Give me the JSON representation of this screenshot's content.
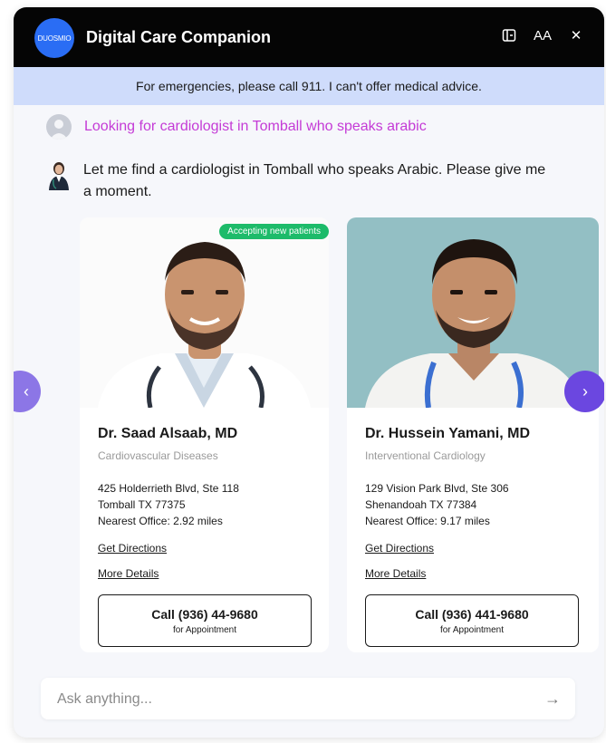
{
  "header": {
    "logo_text": "DUOSMIO",
    "title": "Digital Care Companion",
    "icons": [
      "layout-icon",
      "font-size-icon",
      "close-icon"
    ],
    "font_label": "AA",
    "close_glyph": "✕"
  },
  "banner": {
    "text": "For emergencies, please call 911. I can't offer medical advice."
  },
  "user_message": {
    "text": "Looking for cardiologist in Tomball who speaks arabic"
  },
  "bot_message": {
    "text": "Let me find a cardiologist in Tomball who speaks Arabic. Please give me a moment."
  },
  "cards": [
    {
      "badge": "Accepting new patients",
      "name": "Dr. Saad Alsaab, MD",
      "specialty": "Cardiovascular Diseases",
      "address_line1": "425 Holderrieth Blvd, Ste 118",
      "address_line2": "Tomball TX 77375",
      "nearest_office": "Nearest Office: 2.92 miles",
      "directions_label": "Get Directions",
      "details_label": "More Details",
      "call_label": "Call (936) 44-9680",
      "call_sub": "for Appointment"
    },
    {
      "name": "Dr. Hussein Yamani, MD",
      "specialty": "Interventional Cardiology",
      "address_line1": "129 Vision Park Blvd, Ste 306",
      "address_line2": "Shenandoah TX 77384",
      "nearest_office": "Nearest Office: 9.17 miles",
      "directions_label": "Get Directions",
      "details_label": "More Details",
      "call_label": "Call (936) 441-9680",
      "call_sub": "for Appointment"
    }
  ],
  "carousel": {
    "prev_glyph": "‹",
    "next_glyph": "›"
  },
  "input": {
    "placeholder": "Ask anything...",
    "send_glyph": "→"
  },
  "colors": {
    "header_bg": "#050505",
    "banner_bg": "#cfdcfb",
    "user_text": "#c43bd6",
    "badge": "#1dbb6a",
    "nav_next": "#6b47e0",
    "nav_prev": "#8c76e6",
    "logo": "#2a6df4"
  }
}
